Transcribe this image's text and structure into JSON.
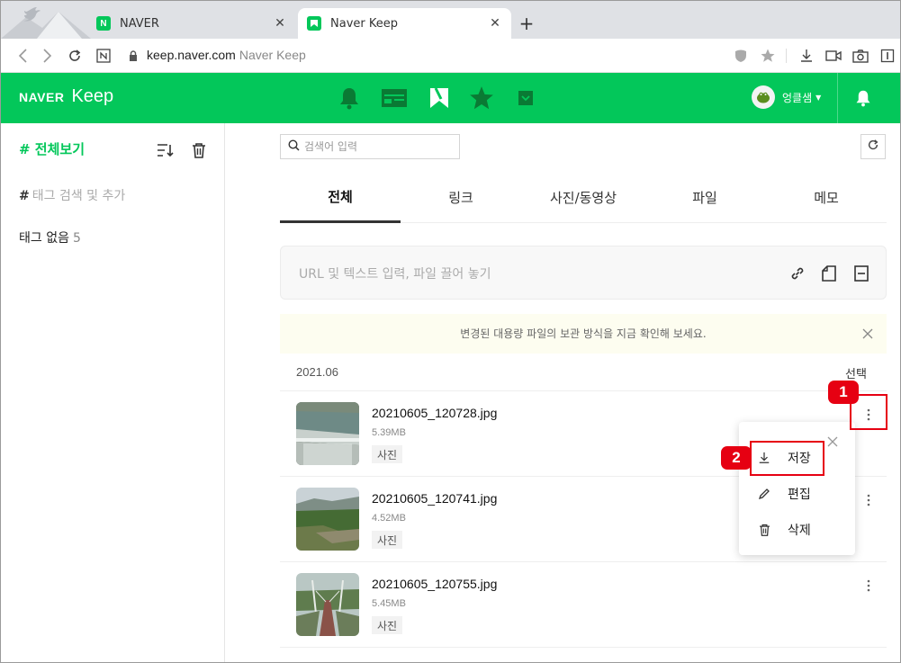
{
  "browser": {
    "tabs": [
      {
        "label": "NAVER",
        "favicon": "N"
      },
      {
        "label": "Naver Keep",
        "favicon": "K"
      }
    ],
    "url": "keep.naver.com",
    "site_name": "Naver Keep"
  },
  "app": {
    "logo_brand": "NAVER",
    "logo_product": "Keep",
    "user_name": "엉클샘",
    "brand_color": "#03c75a"
  },
  "sidebar": {
    "title": "# 전체보기",
    "tag_search_placeholder": "태그 검색 및 추가",
    "no_tag_label": "태그 없음",
    "no_tag_count": "5"
  },
  "main": {
    "search_placeholder": "검색어 입력",
    "tabs": [
      "전체",
      "링크",
      "사진/동영상",
      "파일",
      "메모"
    ],
    "dropzone_placeholder": "URL 및 텍스트 입력, 파일 끌어 놓기",
    "notice": "변경된 대용량 파일의 보관 방식을 지금 확인해 보세요.",
    "month": "2021.06",
    "select_label": "선택",
    "items": [
      {
        "name": "20210605_120728.jpg",
        "size": "5.39MB",
        "tag": "사진"
      },
      {
        "name": "20210605_120741.jpg",
        "size": "4.52MB",
        "tag": "사진"
      },
      {
        "name": "20210605_120755.jpg",
        "size": "5.45MB",
        "tag": "사진"
      }
    ]
  },
  "context_menu": {
    "items": [
      "저장",
      "편집",
      "삭제"
    ]
  },
  "annotations": {
    "badge1": "1",
    "badge2": "2"
  }
}
